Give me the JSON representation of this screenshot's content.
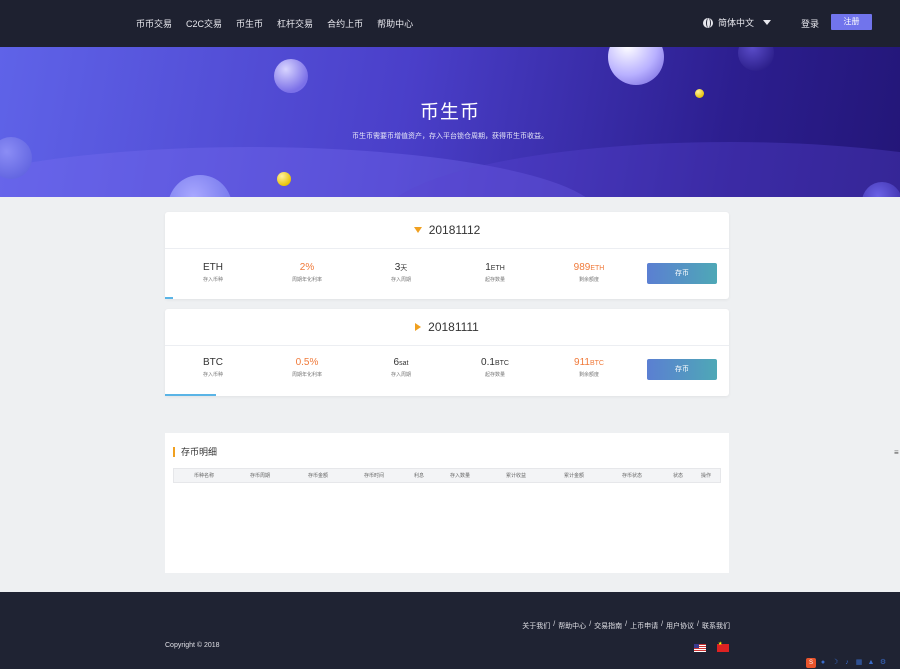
{
  "nav": {
    "links": [
      "币币交易",
      "C2C交易",
      "币生币",
      "杠杆交易",
      "合约上币",
      "帮助中心"
    ],
    "language": "简体中文",
    "login": "登录",
    "register": "注册"
  },
  "hero": {
    "title": "币生币",
    "subtitle": "币生币需要币增值资产，存入平台锁仓周期，获得币生币收益。"
  },
  "products": [
    {
      "name": "20181112",
      "coin": "ETH",
      "coin_label": "存入币种",
      "rate": "2%",
      "rate_label": "周期年化利率",
      "period": "3",
      "period_unit": "天",
      "period_label": "存入周期",
      "min": "1",
      "min_unit": "ETH",
      "min_label": "起存数量",
      "remaining": "989",
      "remaining_unit": "ETH",
      "remaining_label": "剩余额度",
      "button": "存币",
      "progress": 0.015
    },
    {
      "name": "20181111",
      "coin": "BTC",
      "coin_label": "存入币种",
      "rate": "0.5%",
      "rate_label": "周期年化利率",
      "period": "6",
      "period_unit": "sat",
      "period_label": "存入周期",
      "min": "0.1",
      "min_unit": "BTC",
      "min_label": "起存数量",
      "remaining": "911",
      "remaining_unit": "BTC",
      "remaining_label": "剩余额度",
      "button": "存币",
      "progress": 0.09
    }
  ],
  "records": {
    "title": "存币明细",
    "columns": [
      "币种名称",
      "存币周期",
      "存币金额",
      "存币时间",
      "利息",
      "存入数量",
      "累计收益",
      "累计金额",
      "存币状态",
      "状态",
      "操作"
    ]
  },
  "footer": {
    "links": [
      "关于我们",
      "/",
      "帮助中心",
      "/",
      "交易指南",
      "/",
      "上币申请",
      "/",
      "用户协议",
      "/",
      "联系我们"
    ],
    "copyright": "Copyright © 2018"
  },
  "colors": {
    "nav_bg": "#1e2130",
    "accent": "#7174ec",
    "orange": "#f07a3a",
    "footer_bg": "#1f2333"
  }
}
